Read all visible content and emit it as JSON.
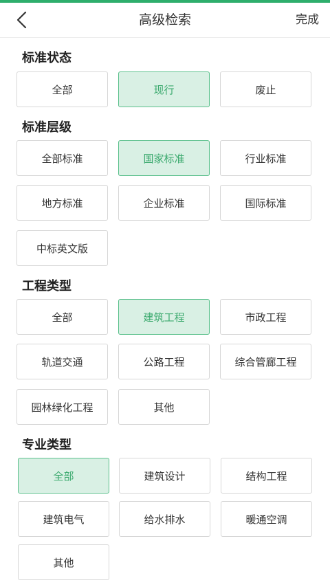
{
  "header": {
    "title": "高级检索",
    "done_label": "完成",
    "back_icon": "chevron-left-icon"
  },
  "colors": {
    "accent": "#2eae6c",
    "selected_bg": "#d9f0e4",
    "selected_text": "#3aa96d"
  },
  "sections": [
    {
      "title": "标准状态",
      "options": [
        "全部",
        "现行",
        "废止"
      ],
      "selected": "现行"
    },
    {
      "title": "标准层级",
      "options": [
        "全部标准",
        "国家标准",
        "行业标准",
        "地方标准",
        "企业标准",
        "国际标准",
        "中标英文版"
      ],
      "selected": "国家标准"
    },
    {
      "title": "工程类型",
      "options": [
        "全部",
        "建筑工程",
        "市政工程",
        "轨道交通",
        "公路工程",
        "综合管廊工程",
        "园林绿化工程",
        "其他"
      ],
      "selected": "建筑工程"
    },
    {
      "title": "专业类型",
      "options": [
        "全部",
        "建筑设计",
        "结构工程",
        "建筑电气",
        "给水排水",
        "暖通空调",
        "其他"
      ],
      "selected": "全部"
    }
  ]
}
